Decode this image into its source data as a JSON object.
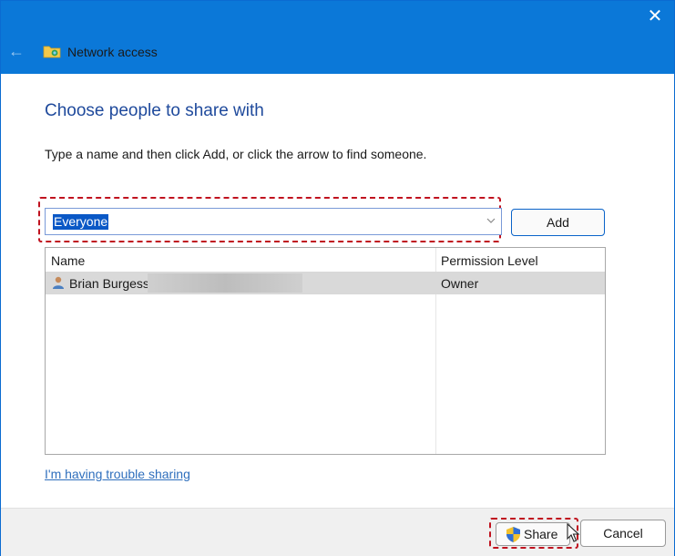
{
  "window": {
    "title": "Network access",
    "close_glyph": "✕",
    "back_glyph": "←",
    "accent_color": "#0b78d8"
  },
  "main": {
    "heading": "Choose people to share with",
    "instruction": "Type a name and then click Add, or click the arrow to find someone.",
    "name_combo": {
      "value": "Everyone"
    },
    "add_label": "Add"
  },
  "people_list": {
    "columns": [
      "Name",
      "Permission Level"
    ],
    "rows": [
      {
        "name": "Brian Burgess",
        "permission": "Owner",
        "icon": "user-icon"
      }
    ]
  },
  "links": {
    "trouble": "I'm having trouble sharing"
  },
  "footer": {
    "share_label": "Share",
    "cancel_label": "Cancel"
  },
  "icons": [
    "network-folder-icon",
    "back-arrow-icon",
    "close-icon",
    "chevron-down-icon",
    "user-icon",
    "uac-shield-icon",
    "mouse-cursor-icon"
  ],
  "colors": {
    "highlight": "#c0121f",
    "heading": "#1f4a9c",
    "link": "#2f6fbd",
    "selection": "#0a58c6"
  }
}
